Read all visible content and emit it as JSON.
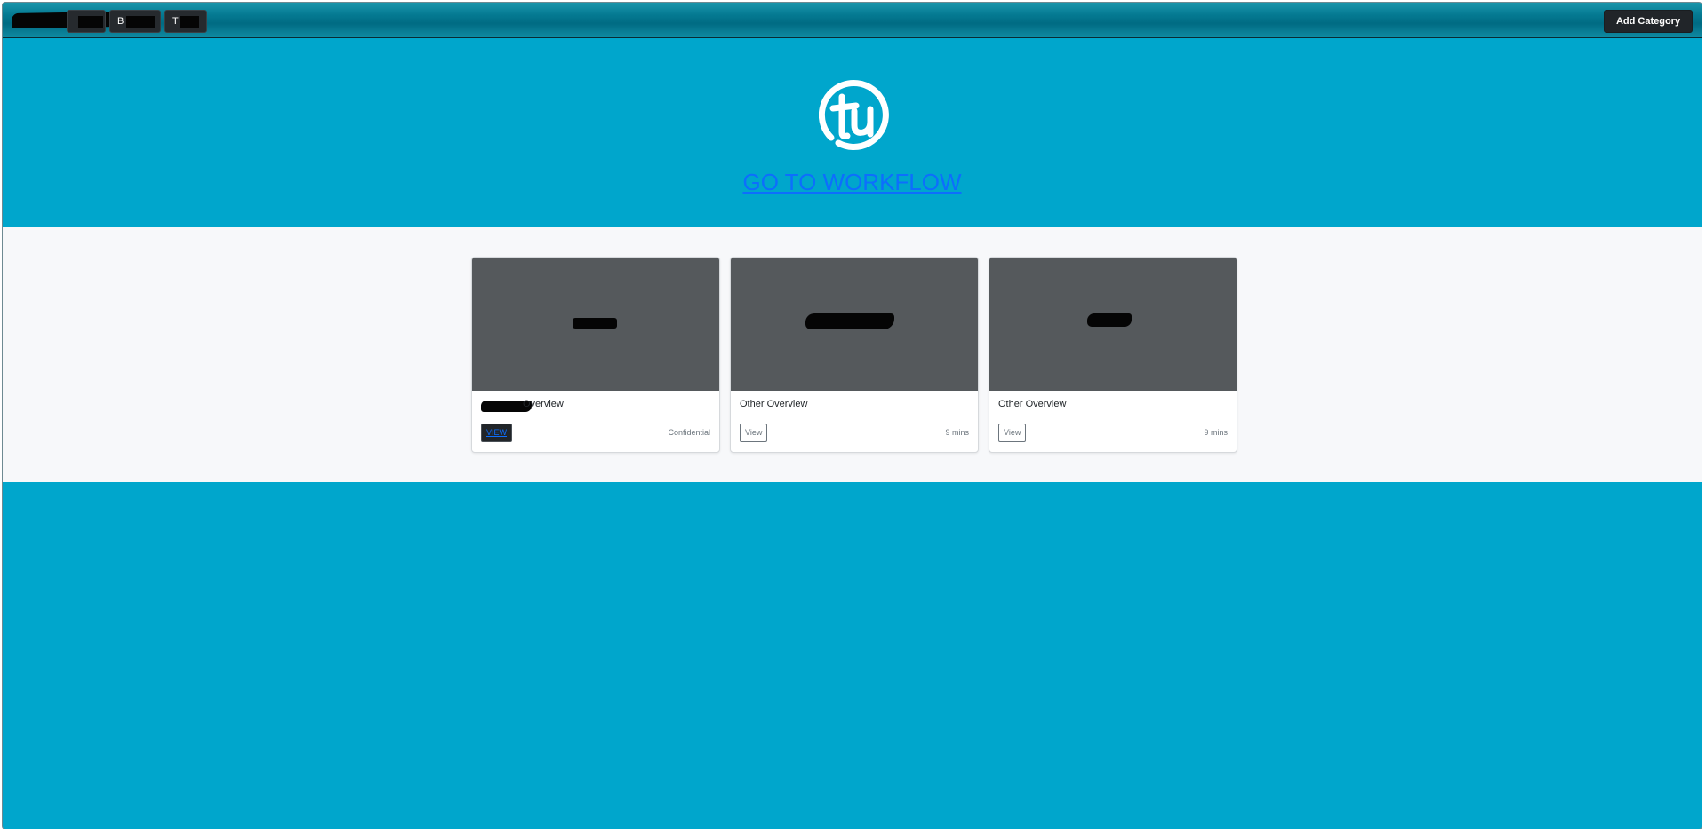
{
  "navbar": {
    "nav_items": [
      {
        "label": "B"
      },
      {
        "label": "T"
      }
    ],
    "add_category_label": "Add Category"
  },
  "hero": {
    "logo_alt": "tu",
    "workflow_link": "GO TO WORKFLOW"
  },
  "cards": [
    {
      "title": "Overview",
      "button": "VIEW",
      "meta": "Confidential"
    },
    {
      "title": "Other Overview",
      "button": "View",
      "meta": "9 mins"
    },
    {
      "title": "Other Overview",
      "button": "View",
      "meta": "9 mins"
    }
  ],
  "colors": {
    "page_background": "#00a6cc",
    "navbar": "#006b83",
    "band_background": "#f7f8fa",
    "thumbnail": "#55595c",
    "link": "#0d6efd",
    "dark_button": "#212529"
  }
}
